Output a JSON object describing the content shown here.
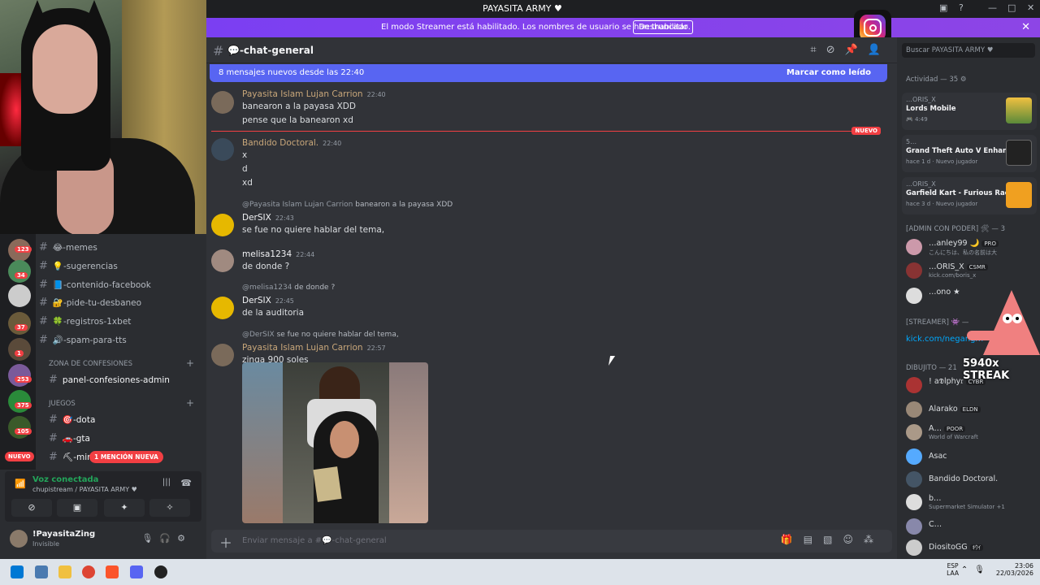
{
  "window": {
    "title": "PAYASITA ARMY ♥"
  },
  "banner": {
    "message": "El modo Streamer está habilitado. Los nombres de usuario se han truncado.",
    "button": "Deshabilitar",
    "close": "✕"
  },
  "channel": {
    "hash": "#",
    "name": "💬-chat-general"
  },
  "new_messages": {
    "text": "8 mensajes nuevos desde las 22:40",
    "mark_read": "Marcar como leído"
  },
  "new_divider": "NUEVO",
  "messages": [
    {
      "author": "Payasita Islam Lujan Carrion",
      "time": "22:40",
      "lines": [
        "banearon a la payasa XDD",
        "pense que la banearon xd"
      ]
    },
    {
      "author": "Bandido Doctoral.",
      "time": "22:40",
      "lines": [
        "x",
        "d",
        "xd"
      ]
    },
    {
      "reply_author": "@Payasita Islam Lujan Carrion",
      "reply_text": "banearon a la payasa XDD",
      "author": "DerSIX",
      "time": "22:43",
      "lines": [
        "se fue no quiere hablar del tema,"
      ]
    },
    {
      "author": "melisa1234",
      "time": "22:44",
      "lines": [
        "de donde ?"
      ]
    },
    {
      "reply_author": "@melisa1234",
      "reply_text": "de donde ?",
      "author": "DerSIX",
      "time": "22:45",
      "lines": [
        "de la auditoria"
      ]
    },
    {
      "reply_author": "@DerSIX",
      "reply_text": "se fue no quiere hablar del tema,",
      "author": "Payasita Islam Lujan Carrion",
      "time": "22:57",
      "lines": [
        "zinga 900 soles"
      ]
    }
  ],
  "input": {
    "placeholder": "Enviar mensaje a #💬-chat-general"
  },
  "sidebar": {
    "channels": [
      {
        "name": "😂-memes",
        "badge": "123"
      },
      {
        "name": "💡-sugerencias",
        "badge": "34"
      },
      {
        "name": "📘-contenido-facebook",
        "badge": ""
      },
      {
        "name": "🔐-pide-tu-desbaneo",
        "badge": "37"
      },
      {
        "name": "🍀-registros-1xbet",
        "badge": "1"
      },
      {
        "name": "🔊-spam-para-tts",
        "badge": ""
      }
    ],
    "category1": "ZONA DE CONFESIONES",
    "channel_confesiones": "panel-confesiones-admin",
    "category2": "JUEGOS",
    "game_channels": [
      "🎯-dota",
      "🚗-gta",
      "⛏-min"
    ],
    "guild_badges": [
      "253",
      "375",
      "105"
    ],
    "nuevo": "NUEVO",
    "mention": "1 MENCIÓN NUEVA"
  },
  "voice": {
    "status": "Voz conectada",
    "server": "chupistream / PAYASITA ARMY ♥"
  },
  "user": {
    "name": "!PayasitaZing",
    "status": "Invisible"
  },
  "members": {
    "search_placeholder": "Buscar PAYASITA ARMY ♥",
    "activity_header": "Actividad — 35 ⚙",
    "activities": [
      {
        "user": "…ORIS_X",
        "game": "Lords Mobile",
        "detail": "🎮 4:49"
      },
      {
        "user": "5…",
        "game": "Grand Theft Auto V Enhan…",
        "detail": "hace 1 d · Nuevo jugador"
      },
      {
        "user": "…ORIS_X",
        "game": "Garfield Kart - Furious Rac…",
        "detail": "hace 3 d · Nuevo jugador"
      }
    ],
    "admin_header": "[ADMIN CON PODER] 🛠 — 3",
    "admins": [
      {
        "name": "…anley99 🌙",
        "tag": "PRO",
        "sub": "こんにちは、私の名前は大"
      },
      {
        "name": "…ORIS_X",
        "tag": "CSMR",
        "sub": "kick.com/boris_x"
      },
      {
        "name": "…ono ★",
        "tag": "",
        "sub": ""
      }
    ],
    "streamer_header": "[STREAMER] 👾 —",
    "kick": "kick.com/negangm",
    "streak": "5940x STREAK",
    "dibujito_header": "DIBUJITO — 21",
    "dibujito": [
      {
        "name": "! a𝕯lphy𝔯",
        "tag": "CYBR",
        "sub": ""
      },
      {
        "name": "Alarako",
        "tag": "ELDN",
        "sub": ""
      },
      {
        "name": "A…",
        "tag": "POOR",
        "sub": "World of Warcraft"
      },
      {
        "name": "Asac",
        "tag": "",
        "sub": ""
      },
      {
        "name": "Bandido Doctoral.",
        "tag": "",
        "sub": ""
      },
      {
        "name": "b…",
        "tag": "",
        "sub": "Supermarket Simulator +1"
      },
      {
        "name": "C…",
        "tag": "",
        "sub": ""
      },
      {
        "name": "DiositoGG",
        "tag": "ｷｳｲ",
        "sub": ""
      }
    ]
  },
  "taskbar": {
    "lang1": "ESP",
    "lang2": "LAA",
    "time": "23:06",
    "date": "22/03/2026"
  },
  "colors": {
    "accent": "#5865f2",
    "banner": "#8d45e6",
    "danger": "#f23f43",
    "online": "#23a55a"
  }
}
